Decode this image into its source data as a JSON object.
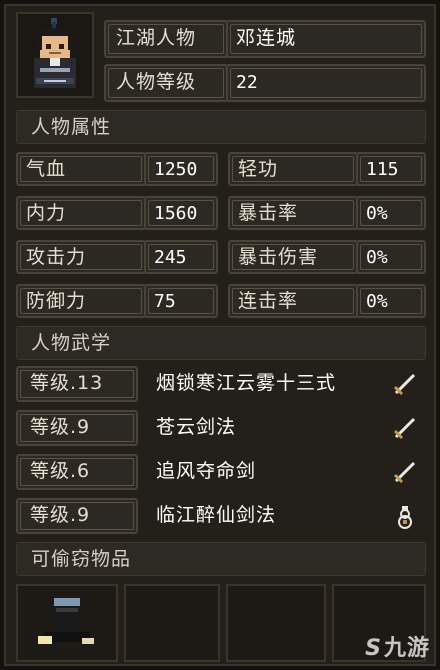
{
  "header": {
    "name_label": "江湖人物",
    "name_value": "邓连城",
    "level_label": "人物等级",
    "level_value": "22"
  },
  "attributes": {
    "section_title": "人物属性",
    "items": [
      {
        "label": "气血",
        "value": "1250"
      },
      {
        "label": "轻功",
        "value": "115"
      },
      {
        "label": "内力",
        "value": "1560"
      },
      {
        "label": "暴击率",
        "value": "0%"
      },
      {
        "label": "攻击力",
        "value": "245"
      },
      {
        "label": "暴击伤害",
        "value": "0%"
      },
      {
        "label": "防御力",
        "value": "75"
      },
      {
        "label": "连击率",
        "value": "0%"
      }
    ]
  },
  "martial": {
    "section_title": "人物武学",
    "skills": [
      {
        "level": "等级.13",
        "name": "烟锁寒江云雾十三式",
        "icon": "sword-icon"
      },
      {
        "level": "等级.9",
        "name": "苍云剑法",
        "icon": "sword-icon"
      },
      {
        "level": "等级.6",
        "name": "追风夺命剑",
        "icon": "sword-icon"
      },
      {
        "level": "等级.9",
        "name": "临江醉仙剑法",
        "icon": "wine-gourd-icon"
      }
    ]
  },
  "stealable": {
    "section_title": "可偷窃物品",
    "slots": [
      {
        "icon": "hat-item-icon"
      },
      {
        "icon": ""
      },
      {
        "icon": ""
      },
      {
        "icon": ""
      }
    ]
  },
  "watermark": {
    "logo": "S",
    "text": "九游"
  },
  "colors": {
    "background": "#232019",
    "box_border": "#4a4338",
    "text": "#e6dfd0"
  }
}
